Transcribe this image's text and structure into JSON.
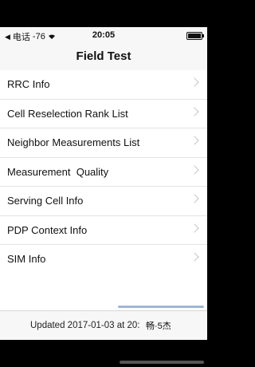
{
  "status_bar": {
    "carrier": "电话",
    "signal": "-76",
    "time": "20:05"
  },
  "navbar": {
    "title": "Field Test"
  },
  "menu": {
    "items": [
      {
        "label": "RRC Info"
      },
      {
        "label": "Cell Reselection Rank List"
      },
      {
        "label": "Neighbor Measurements List"
      },
      {
        "label": "Measurement  Quality"
      },
      {
        "label": "Serving Cell Info"
      },
      {
        "label": "PDP Context Info"
      },
      {
        "label": "SIM Info"
      }
    ]
  },
  "footer": {
    "updated": "Updated 2017-01-03 at 20:",
    "watermark": "畅·5杰"
  }
}
